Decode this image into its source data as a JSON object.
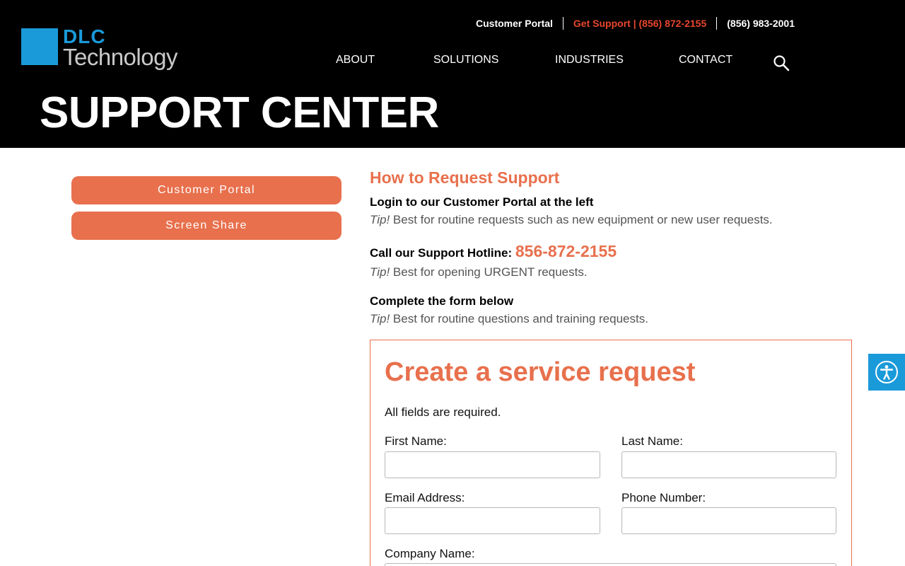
{
  "brand": {
    "logo_line1": "DLC",
    "logo_line2": "Technology",
    "logo_color": "#1a9ad9"
  },
  "topbar": {
    "customer_portal": "Customer Portal",
    "get_support": "Get Support | (856) 872-2155",
    "phone": "(856) 983-2001"
  },
  "nav": {
    "items": [
      "ABOUT",
      "SOLUTIONS",
      "INDUSTRIES",
      "CONTACT"
    ],
    "search_icon": "search-icon"
  },
  "page_title": "SUPPORT CENTER",
  "sidebar": {
    "buttons": [
      "Customer Portal",
      "Screen Share"
    ]
  },
  "main": {
    "heading": "How to Request Support",
    "step1_title": "Login to our Customer Portal at the left",
    "step1_tip_label": "Tip!",
    "step1_tip": " Best for routine requests such as new equipment or new user requests.",
    "step2_title": "Call our Support Hotline:",
    "step2_hotline": "856-872-2155",
    "step2_tip_label": "Tip!",
    "step2_tip": " Best for opening URGENT requests.",
    "step3_title": "Complete the form below",
    "step3_tip_label": "Tip!",
    "step3_tip": " Best for routine questions and training requests."
  },
  "form": {
    "title": "Create a service request",
    "note": "All fields are required.",
    "first_name_label": "First Name:",
    "first_name_value": "",
    "last_name_label": "Last Name:",
    "last_name_value": "",
    "email_label": "Email Address:",
    "email_value": "",
    "phone_label": "Phone Number:",
    "phone_value": "",
    "company_label": "Company Name:",
    "company_value": ""
  },
  "accessibility": {
    "icon": "accessibility-icon"
  },
  "colors": {
    "accent": "#e8704d",
    "support_red": "#e8462e",
    "header_bg": "#000000",
    "accessibility_bg": "#1a9ad9"
  }
}
